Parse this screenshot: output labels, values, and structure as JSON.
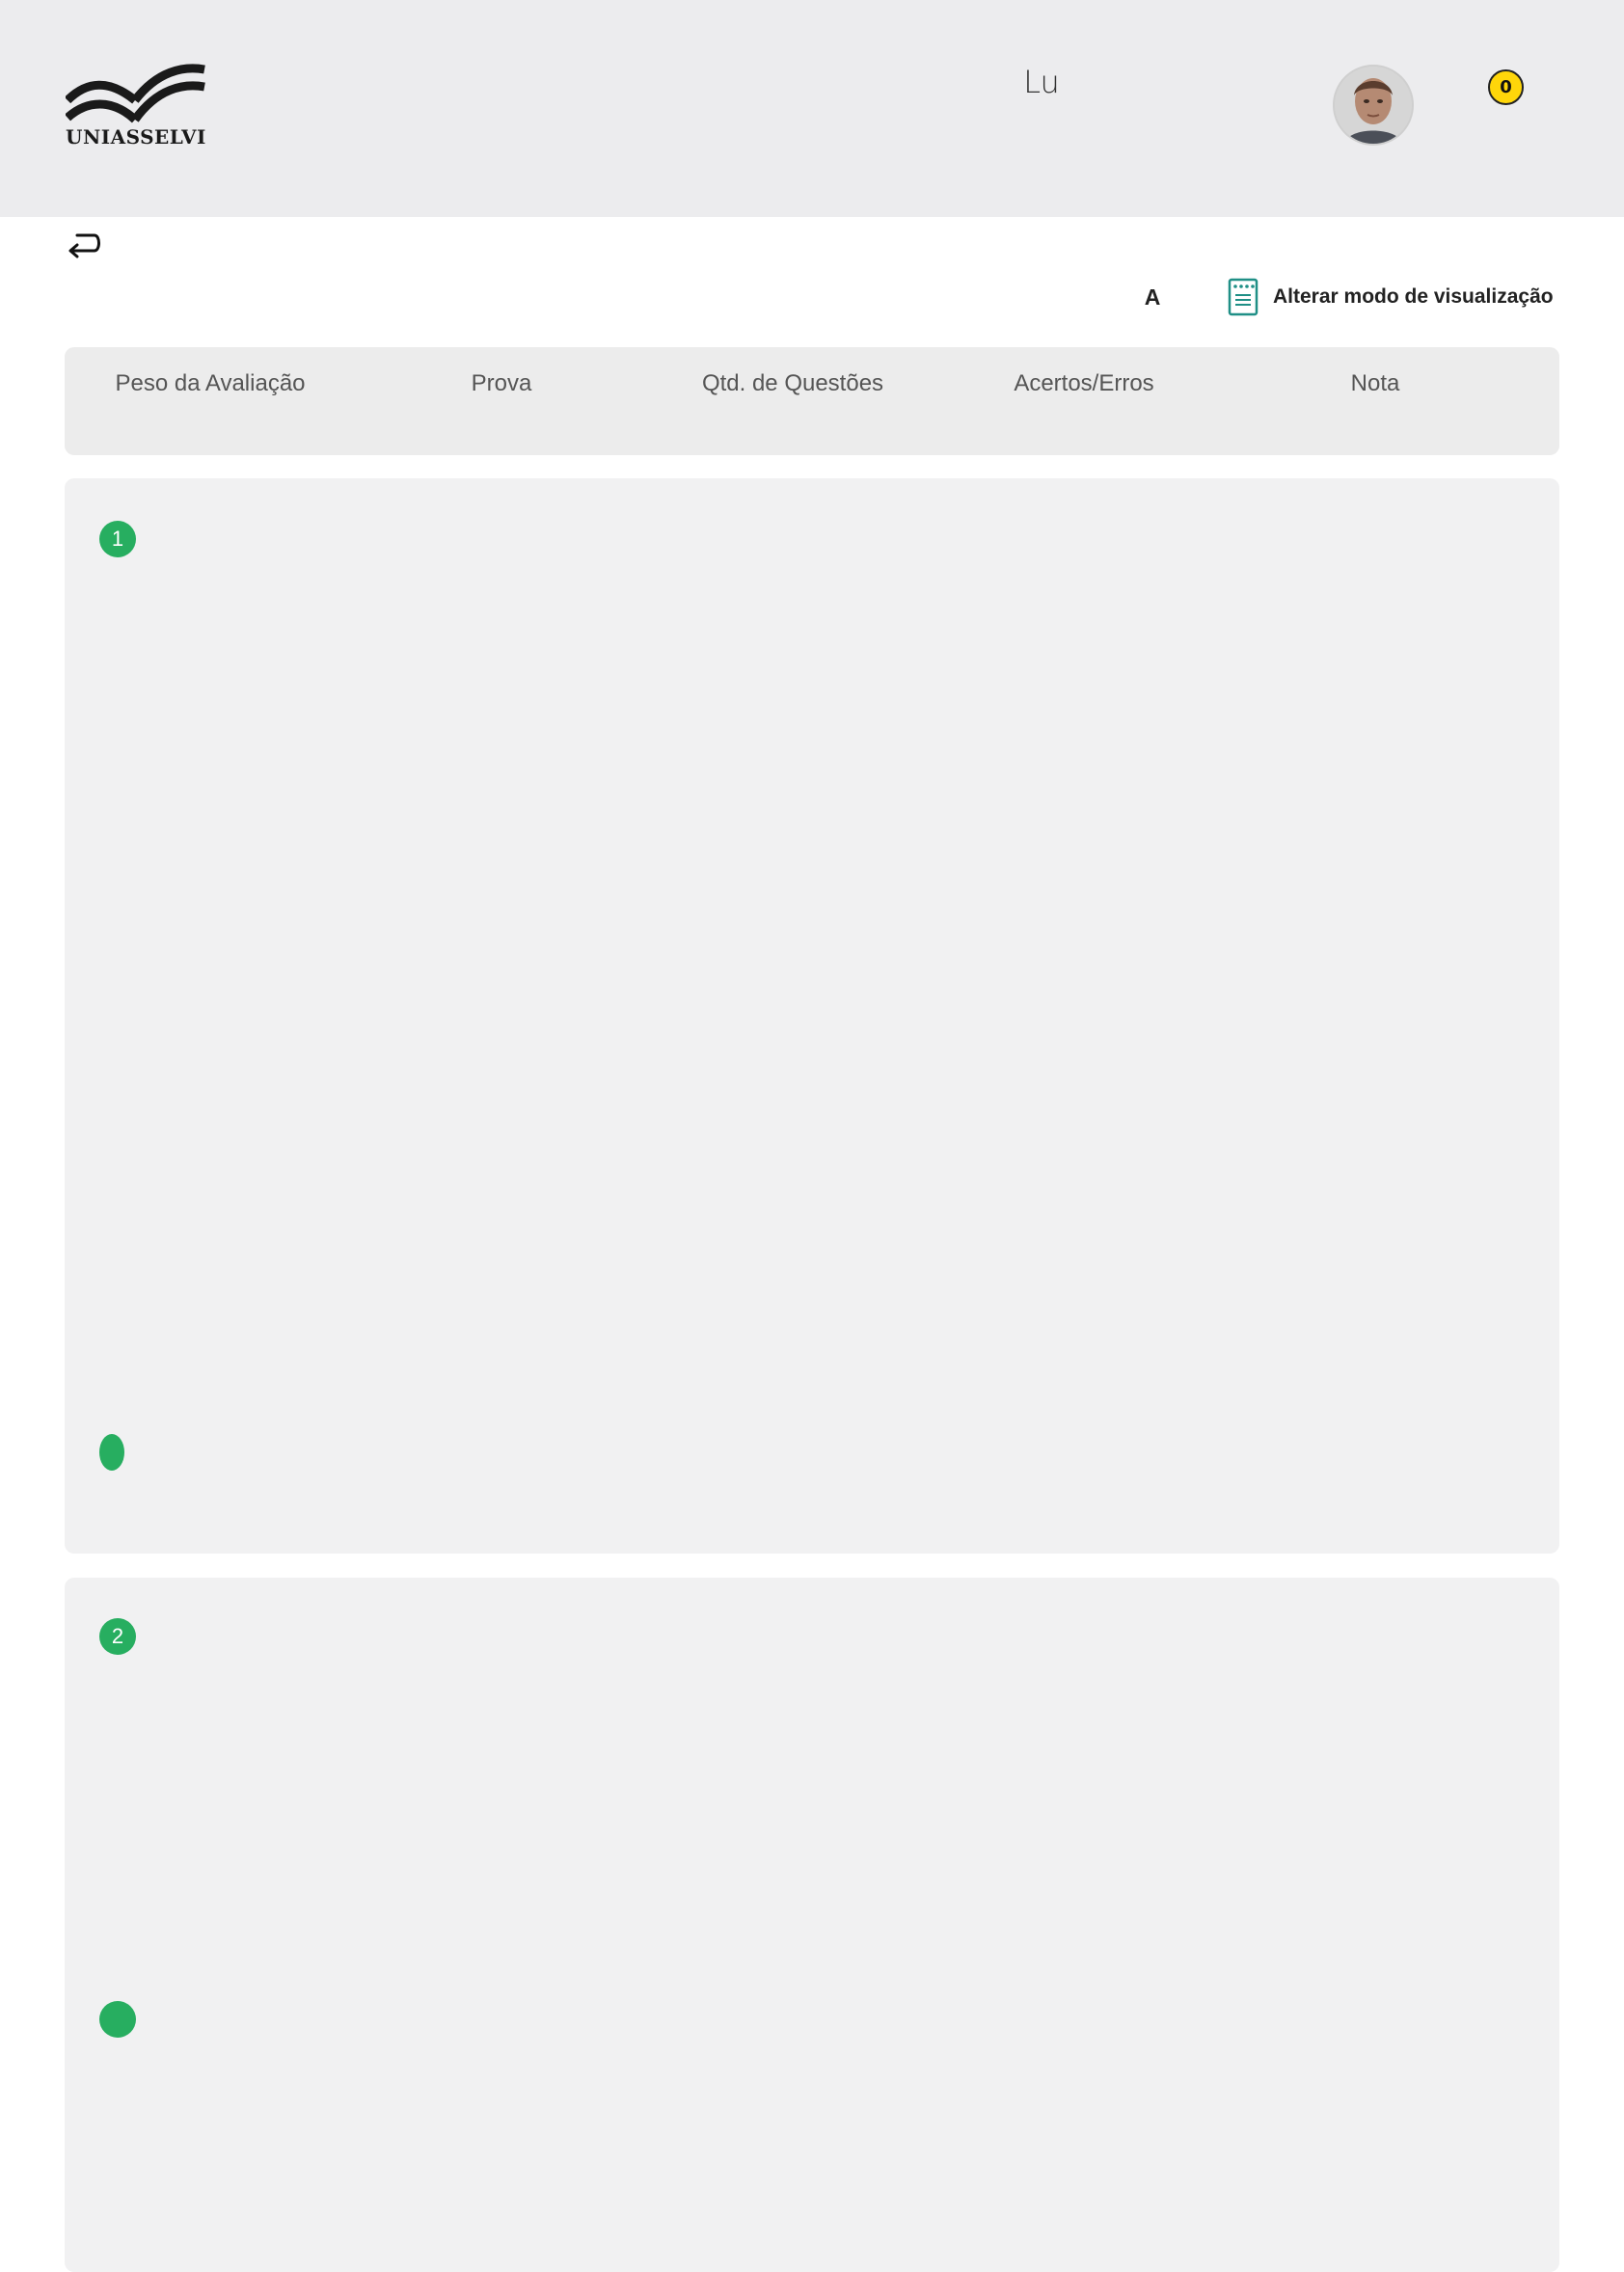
{
  "header": {
    "logo_text": "UNIASSELVI",
    "user_name": "Lu",
    "notifications_count": "0"
  },
  "toolbar": {
    "font_size_label": "A",
    "view_mode_label": "Alterar modo de visualização"
  },
  "summary": {
    "columns": [
      "Peso da Avaliação",
      "Prova",
      "Qtd. de Questões",
      "Acertos/Erros",
      "Nota"
    ]
  },
  "questions": [
    {
      "number": "1"
    },
    {
      "number": "2"
    }
  ],
  "colors": {
    "accent_green": "#27ae60",
    "badge_yellow": "#ffd60a",
    "header_bg": "#ececee",
    "card_bg": "#f1f1f2"
  }
}
